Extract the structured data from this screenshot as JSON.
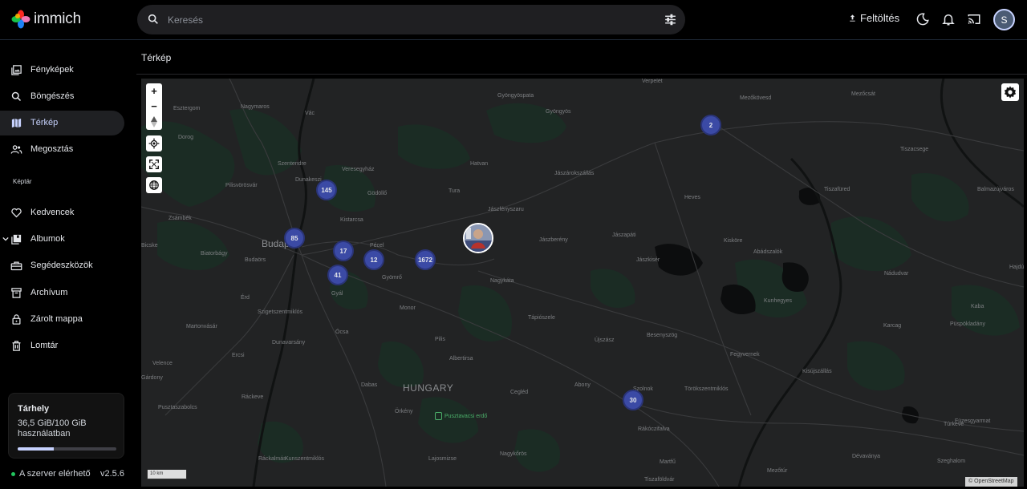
{
  "app": {
    "name": "immich"
  },
  "header": {
    "search_placeholder": "Keresés",
    "upload_label": "Feltöltés",
    "avatar_initial": "S"
  },
  "sidebar": {
    "items": [
      {
        "label": "Fényképek",
        "icon": "photos-icon"
      },
      {
        "label": "Böngészés",
        "icon": "search-icon"
      },
      {
        "label": "Térkép",
        "icon": "map-icon",
        "active": true
      },
      {
        "label": "Megosztás",
        "icon": "share-people-icon"
      }
    ],
    "section_label": "Képtár",
    "library_items": [
      {
        "label": "Kedvencek",
        "icon": "heart-icon"
      },
      {
        "label": "Albumok",
        "icon": "album-icon"
      },
      {
        "label": "Segédeszközök",
        "icon": "toolbox-icon"
      },
      {
        "label": "Archívum",
        "icon": "archive-icon"
      },
      {
        "label": "Zárolt mappa",
        "icon": "lock-icon"
      },
      {
        "label": "Lomtár",
        "icon": "trash-icon"
      }
    ],
    "storage": {
      "title": "Tárhely",
      "usage_text": "36,5 GiB/100 GiB használatban",
      "used_fraction": 0.365
    },
    "server_status": "A szerver elérhető",
    "version": "v2.5.6"
  },
  "main": {
    "title": "Térkép",
    "map": {
      "clusters": [
        "2",
        "145",
        "85",
        "17",
        "12",
        "1672",
        "41",
        "30"
      ],
      "places": [
        "Verpelét",
        "Mezőkövesd",
        "Mezőcsát",
        "Gyöngyöspata",
        "Gyöngyös",
        "Esztergom",
        "Nagymaros",
        "Vác",
        "Dorog",
        "Szentendre",
        "Veresegyház",
        "Hatvan",
        "Jászárokszállás",
        "Tiszacsege",
        "Dunakeszi",
        "Pilisvörösvár",
        "Gödöllő",
        "Tura",
        "Heves",
        "Tiszafüred",
        "Balmazújváros",
        "Zsámbék",
        "Jászfényszaru",
        "Kistarcsa",
        "Pécel",
        "Budaörs",
        "Biatorbágy",
        "Bicske",
        "Jászberény",
        "Jászapáti",
        "Kisköre",
        "Abádszalók",
        "Jászkisér",
        "Hajdúszob",
        "Nádudvar",
        "Gyömrő",
        "Nagykáta",
        "Érd",
        "Gyál",
        "Monor",
        "Kunhegyes",
        "Kaba",
        "Szigetszentmiklós",
        "Tápiószele",
        "Martonvásár",
        "Karcag",
        "Püspökladány",
        "Ócsa",
        "Besenyszög",
        "Újszász",
        "Dunavarsány",
        "Pilis",
        "Fegyvernek",
        "Ercsi",
        "Albertirsa",
        "Velence",
        "Gárdony",
        "Kisújszállás",
        "Abony",
        "Dabas",
        "Cegléd",
        "Törökszentmiklós",
        "Ráckeve",
        "Pusztaszabolcs",
        "Szolnok",
        "Örkény",
        "Füzesgyarmat",
        "Rákóczifalva",
        "Túrkeve",
        "Ráckalmás",
        "Kunszentmiklós",
        "Lajosmizse",
        "Nagykőrös",
        "Martfű",
        "Dévaványa",
        "Szeghalom",
        "Tiszaföldvár",
        "Mezőtúr",
        "Budapest"
      ],
      "country_label": "HUNGARY",
      "poi_label": "Pusztavacsi erdő",
      "scale_label": "10 km",
      "attribution": "© OpenStreetMap",
      "zoom_in": "+",
      "zoom_out": "−"
    }
  },
  "colors": {
    "accent": "#c7d2fe",
    "cluster": "#3b4aa5",
    "map_bg": "#222324",
    "server_online": "#22c55e"
  }
}
